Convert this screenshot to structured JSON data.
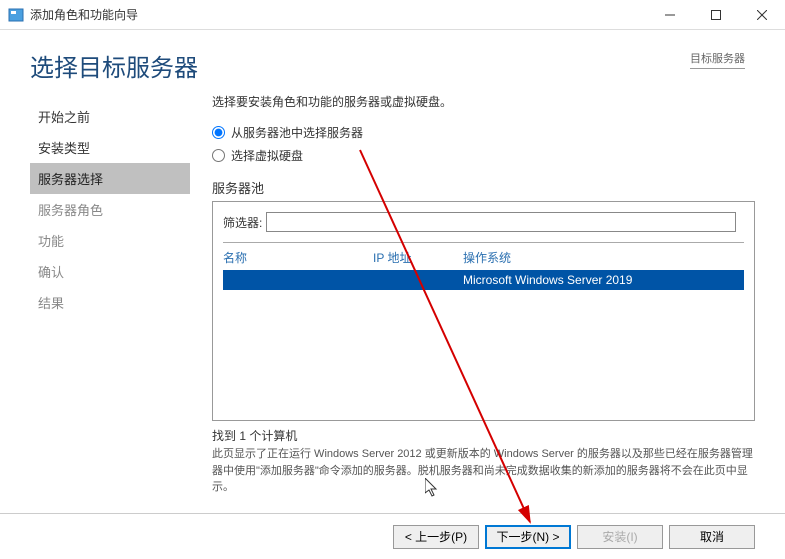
{
  "window": {
    "title": "添加角色和功能向导"
  },
  "header": {
    "page_title": "选择目标服务器",
    "dest_label": "目标服务器"
  },
  "sidebar": {
    "items": [
      {
        "label": "开始之前"
      },
      {
        "label": "安装类型"
      },
      {
        "label": "服务器选择"
      },
      {
        "label": "服务器角色"
      },
      {
        "label": "功能"
      },
      {
        "label": "确认"
      },
      {
        "label": "结果"
      }
    ]
  },
  "content": {
    "instruction": "选择要安装角色和功能的服务器或虚拟硬盘。",
    "radio1": "从服务器池中选择服务器",
    "radio2": "选择虚拟硬盘",
    "pool_label": "服务器池",
    "filter_label": "筛选器:",
    "columns": {
      "name": "名称",
      "ip": "IP 地址",
      "os": "操作系统"
    },
    "rows": [
      {
        "name": "",
        "ip": "",
        "os": "Microsoft Windows Server 2019"
      }
    ],
    "found_label": "找到 1 个计算机",
    "help_text": "此页显示了正在运行 Windows Server 2012 或更新版本的 Windows Server 的服务器以及那些已经在服务器管理器中使用\"添加服务器\"命令添加的服务器。脱机服务器和尚未完成数据收集的新添加的服务器将不会在此页中显示。"
  },
  "footer": {
    "prev": "< 上一步(P)",
    "next": "下一步(N) >",
    "install": "安装(I)",
    "cancel": "取消"
  }
}
